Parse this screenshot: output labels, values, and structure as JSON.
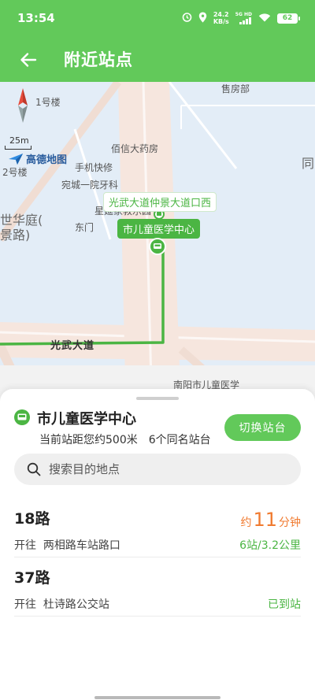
{
  "status": {
    "time": "13:54",
    "net_speed_value": "24.2",
    "net_speed_unit": "KB/s",
    "network": "5G HD",
    "battery": "62"
  },
  "header": {
    "title": "附近站点",
    "back_icon": "arrow-left-icon"
  },
  "map": {
    "scale": "25m",
    "logo": "高德地图",
    "labels": {
      "building1": "1号楼",
      "building2": "2号楼",
      "ticket": "售房部",
      "pharmacy": "佰信大药房",
      "phone_repair": "手机快修",
      "dental": "宛城一院牙科",
      "teach": "星延家教乐园",
      "east_gate": "东门",
      "world1": "世华庭(",
      "world2": "景路)",
      "right_partial": "同",
      "hospital_bottom": "南阳市儿童医学"
    },
    "road": "光武大道",
    "stop_west": "光武大道仲景大道口西",
    "stop_current": "市儿童医学中心"
  },
  "sheet": {
    "stop_name": "市儿童医学中心",
    "distance_text": "当前站距您约500米",
    "same_name_text": "6个同名站台",
    "switch_button": "切换站台",
    "search_placeholder": "搜索目的地点"
  },
  "routes": [
    {
      "name": "18路",
      "direction_prefix": "开往",
      "destination": "两相路车站路口",
      "eta_prefix": "约",
      "eta_value": "11",
      "eta_unit": "分钟",
      "info": "6站/3.2公里"
    },
    {
      "name": "37路",
      "direction_prefix": "开往",
      "destination": "杜诗路公交站",
      "info": "已到站"
    }
  ],
  "colors": {
    "brand_green": "#62c95a",
    "accent_green": "#4bb543",
    "eta_orange": "#f07a2f"
  }
}
